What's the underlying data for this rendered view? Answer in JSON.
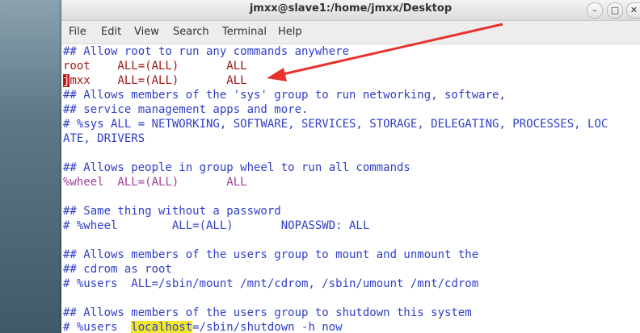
{
  "window": {
    "title": "jmxx@slave1:/home/jmxx/Desktop",
    "minimize_glyph": "–",
    "maximize_glyph": "□",
    "close_glyph": "✕"
  },
  "menu": [
    "File",
    "Edit",
    "View",
    "Search",
    "Terminal",
    "Help"
  ],
  "terminal": {
    "cursor_char": "j",
    "lines": [
      "## Allow root to run any commands anywhere",
      "root    ALL=(ALL)       ALL",
      "mxx    ALL=(ALL)       ALL",
      "## Allows members of the 'sys' group to run networking, software,",
      "## service management apps and more.",
      "# %sys ALL = NETWORKING, SOFTWARE, SERVICES, STORAGE, DELEGATING, PROCESSES, LOC",
      "ATE, DRIVERS",
      "",
      "## Allows people in group wheel to run all commands",
      "%wheel  ALL=(ALL)       ALL",
      "",
      "## Same thing without a password",
      "# %wheel        ALL=(ALL)       NOPASSWD: ALL",
      "",
      "## Allows members of the users group to mount and unmount the",
      "## cdrom as root",
      "# %users  ALL=/sbin/mount /mnt/cdrom, /sbin/umount /mnt/cdrom",
      "",
      "## Allows members of the users group to shutdown this system",
      "# %users  ",
      "=/sbin/shutdown -h now"
    ],
    "highlight_word": "localhost"
  },
  "colors": {
    "comment": "#2f3fc7",
    "user": "#a01414",
    "cursor_bg": "#c61818",
    "highlight_bg": "#f2e62a",
    "arrow": "#e8322c"
  },
  "icons": [
    "minimize-icon",
    "maximize-icon",
    "close-icon",
    "annotation-arrow"
  ]
}
